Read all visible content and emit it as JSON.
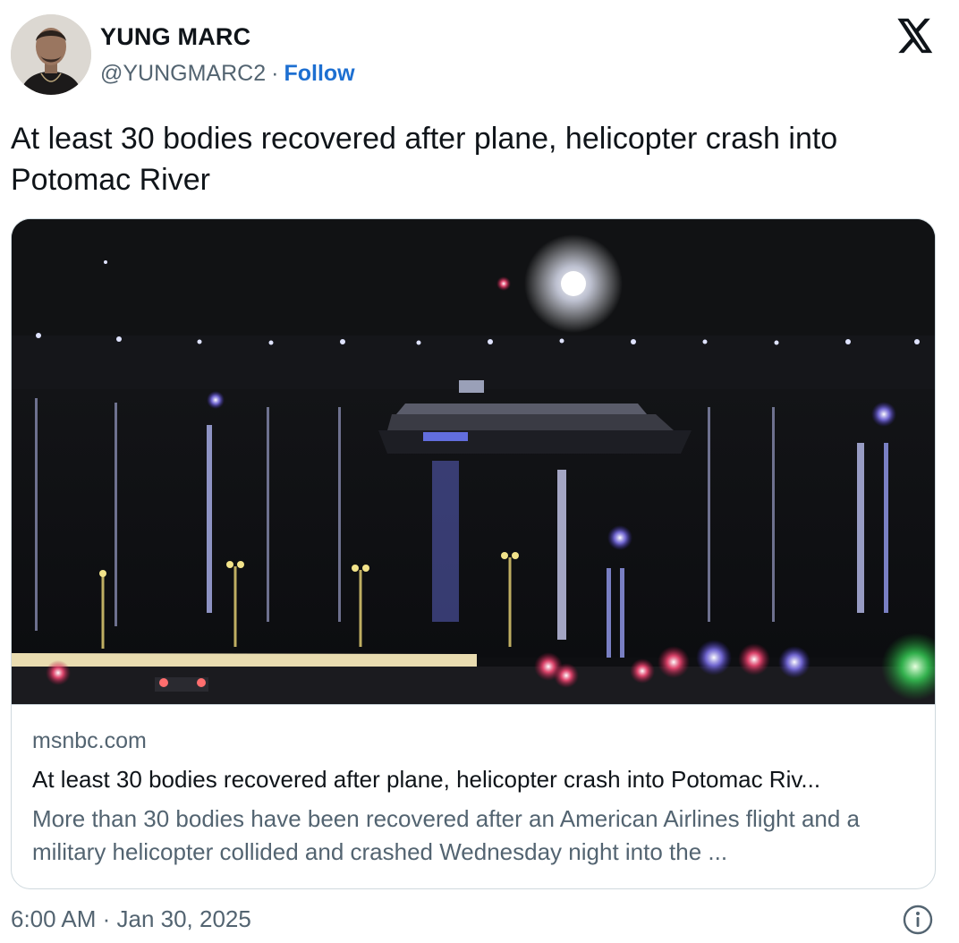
{
  "author": {
    "display_name": "YUNG MARC",
    "handle": "@YUNGMARC2",
    "separator": "·",
    "follow_label": "Follow"
  },
  "tweet": {
    "text": "At least 30 bodies recovered after plane, helicopter crash into Potomac River"
  },
  "card": {
    "domain": "msnbc.com",
    "title": "At least 30 bodies recovered after plane, helicopter crash into Potomac Riv...",
    "description": "More than 30 bodies have been recovered after an American Airlines flight and a military helicopter collided and crashed Wednesday night into the ..."
  },
  "footer": {
    "timestamp": "6:00 AM · Jan 30, 2025"
  },
  "icons": {
    "brand": "x-logo-icon",
    "info": "info-icon"
  },
  "colors": {
    "text_primary": "#0f1419",
    "text_secondary": "#536471",
    "follow_link": "#1d6fd1",
    "border": "#cfd9de"
  }
}
